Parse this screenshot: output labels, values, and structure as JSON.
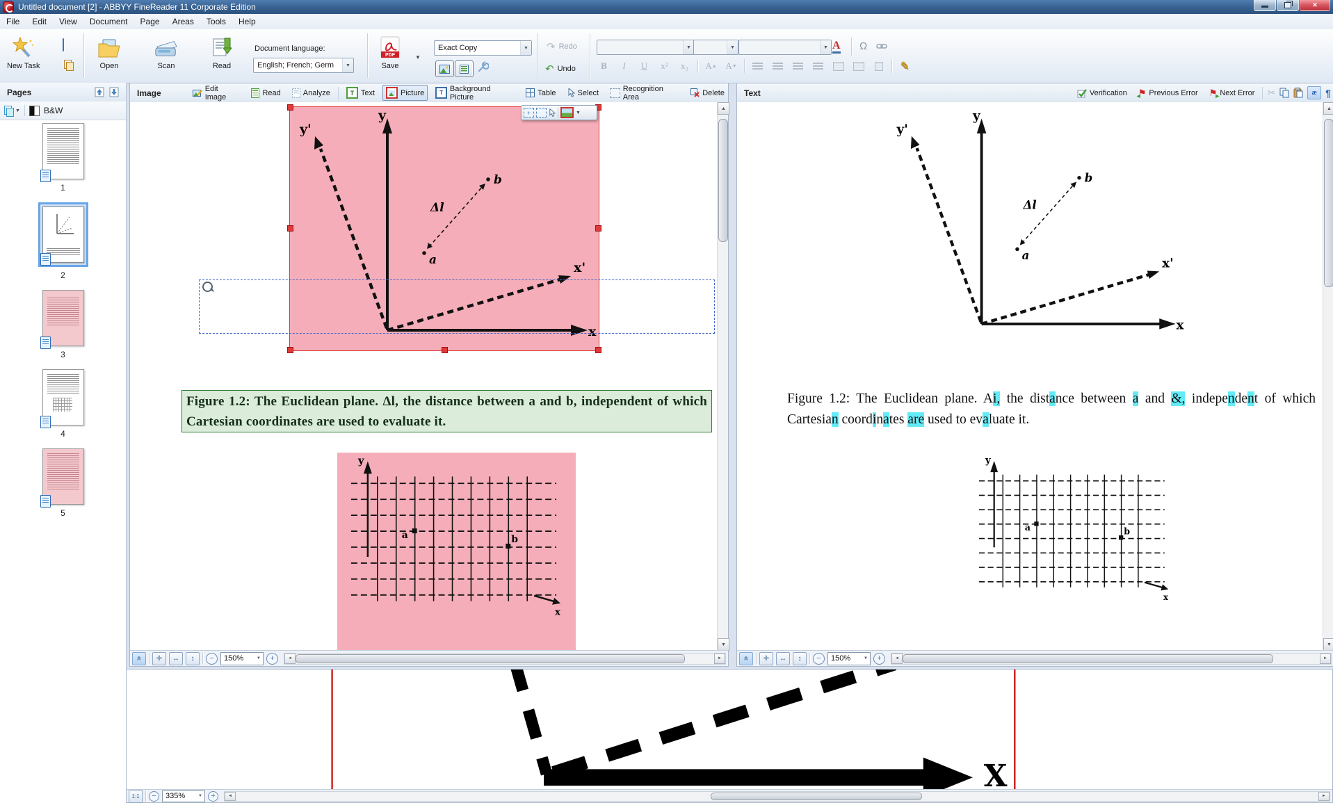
{
  "window": {
    "title": "Untitled document [2] - ABBYY FineReader 11 Corporate Edition"
  },
  "menu": {
    "items": [
      "File",
      "Edit",
      "View",
      "Document",
      "Page",
      "Areas",
      "Tools",
      "Help"
    ]
  },
  "toolbar": {
    "new_task_label": "New Task",
    "open_label": "Open",
    "scan_label": "Scan",
    "read_label": "Read",
    "document_language_label": "Document language:",
    "document_language_value": "English; French; Germ",
    "save_label": "Save",
    "pdf_badge": "PDF",
    "mode_select_value": "Exact Copy",
    "redo_label": "Redo",
    "undo_label": "Undo",
    "bold": "B",
    "italic": "I",
    "underline": "U",
    "superscript": "x²",
    "subscript": "x₂",
    "font_increase": "A",
    "font_decrease": "A",
    "font_color": "A",
    "omega": "Ω"
  },
  "pages_panel": {
    "title": "Pages",
    "bw_label": "B&W",
    "pages": [
      {
        "num": "1"
      },
      {
        "num": "2"
      },
      {
        "num": "3"
      },
      {
        "num": "4"
      },
      {
        "num": "5"
      }
    ]
  },
  "image_panel": {
    "title": "Image",
    "toolbar": {
      "edit_image": "Edit Image",
      "read": "Read",
      "analyze": "Analyze",
      "text": "Text",
      "picture": "Picture",
      "background_picture": "Background Picture",
      "table": "Table",
      "select": "Select",
      "recognition_area": "Recognition Area",
      "delete": "Delete"
    },
    "status": {
      "zoom": "150%"
    }
  },
  "text_panel": {
    "title": "Text",
    "toolbar": {
      "verification": "Verification",
      "previous_error": "Previous Error",
      "next_error": "Next Error",
      "ae": "æ",
      "pilcrow": "¶"
    },
    "status": {
      "zoom": "150%"
    }
  },
  "figure": {
    "labels": {
      "y": "y",
      "y_prime": "y'",
      "x": "x",
      "x_prime": "x'",
      "a": "a",
      "b": "b",
      "delta_l": "Δl"
    },
    "grid_labels": {
      "y": "y",
      "x": "x",
      "a": "a",
      "b": "b"
    },
    "caption_image": "Figure 1.2:  The Euclidean plane.  Δl, the distance between a and b, independent of which Cartesian coordinates are used to evaluate it.",
    "caption_text_segments": [
      {
        "t": "Figure 1.2:  The Euclidean plane.  A",
        "h": false
      },
      {
        "t": "i,",
        "h": true
      },
      {
        "t": " the dist",
        "h": false
      },
      {
        "t": "a",
        "h": true
      },
      {
        "t": "nce between ",
        "h": false
      },
      {
        "t": "a",
        "h": true
      },
      {
        "t": " and ",
        "h": false
      },
      {
        "t": "&,",
        "h": true
      },
      {
        "t": " indepe",
        "h": false
      },
      {
        "t": "n",
        "h": true
      },
      {
        "t": "de",
        "h": false
      },
      {
        "t": "n",
        "h": true
      },
      {
        "t": "t of which Cartesia",
        "h": false
      },
      {
        "t": "n",
        "h": true
      },
      {
        "t": " coord",
        "h": false
      },
      {
        "t": "i",
        "h": true
      },
      {
        "t": "n",
        "h": false
      },
      {
        "t": "a",
        "h": true
      },
      {
        "t": "tes ",
        "h": false
      },
      {
        "t": "are",
        "h": true
      },
      {
        "t": " used to ev",
        "h": false
      },
      {
        "t": "a",
        "h": true
      },
      {
        "t": "luate it.",
        "h": false
      }
    ]
  },
  "bottom_pane": {
    "x_label": "X",
    "status": {
      "zoom": "335%",
      "one_to_one": "1:1"
    }
  },
  "status_shared": {
    "minus": "−",
    "plus": "+"
  },
  "colors": {
    "titlebar": "#3a6aa4",
    "accent": "#3f76b8",
    "selection_fill": "#f5aeb9",
    "selection_border": "#e03a3a",
    "caption_bg": "#dcecdb",
    "caption_border": "#2f7b33",
    "ocr_highlight": "#63ecf7"
  }
}
